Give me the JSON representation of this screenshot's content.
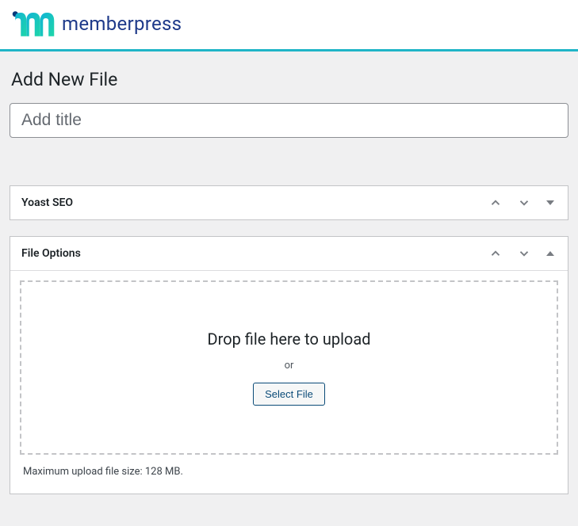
{
  "brand": {
    "name": "memberpress"
  },
  "page": {
    "title": "Add New File",
    "title_placeholder": "Add title"
  },
  "panels": {
    "yoast": {
      "title": "Yoast SEO"
    },
    "file_options": {
      "title": "File Options",
      "upload": {
        "drop_text": "Drop file here to upload",
        "or_text": "or",
        "select_button": "Select File"
      },
      "max_size_text": "Maximum upload file size: 128 MB."
    }
  }
}
